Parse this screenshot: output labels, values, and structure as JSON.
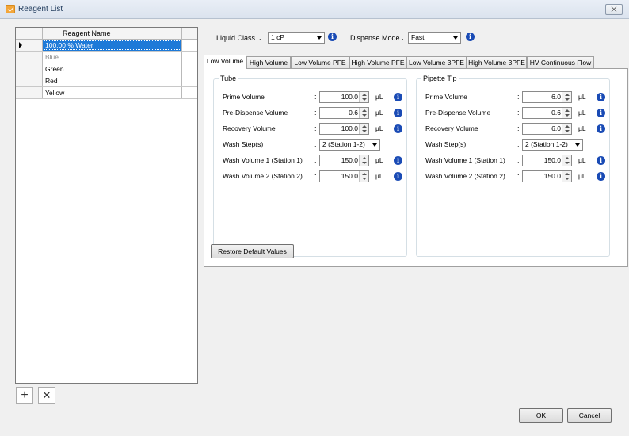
{
  "window": {
    "title": "Reagent List",
    "close_label": "⨉"
  },
  "grid": {
    "header": "Reagent Name",
    "rows": [
      {
        "name": "100.00 % Water"
      },
      {
        "name": "Blue"
      },
      {
        "name": "Green"
      },
      {
        "name": "Red"
      },
      {
        "name": "Yellow"
      }
    ]
  },
  "list_buttons": {
    "add": "+",
    "remove": "✕"
  },
  "liquid_class": {
    "label": "Liquid Class",
    "colon": ":",
    "value": "1 cP"
  },
  "dispense_mode": {
    "label": "Dispense Mode",
    "colon": ":",
    "value": "Fast"
  },
  "info_glyph": "i",
  "tabs": [
    {
      "label": "Low Volume"
    },
    {
      "label": "High Volume"
    },
    {
      "label": "Low Volume PFE"
    },
    {
      "label": "High Volume PFE"
    },
    {
      "label": "Low Volume 3PFE"
    },
    {
      "label": "High Volume 3PFE"
    },
    {
      "label": "HV Continuous Flow"
    }
  ],
  "tube": {
    "title": "Tube",
    "prime": {
      "label": "Prime Volume",
      "value": "100.0",
      "unit": "µL"
    },
    "predispense": {
      "label": "Pre-Dispense Volume",
      "value": "0.6",
      "unit": "µL"
    },
    "recovery": {
      "label": "Recovery Volume",
      "value": "100.0",
      "unit": "µL"
    },
    "wash_steps": {
      "label": "Wash Step(s)",
      "value": "2 (Station 1-2)"
    },
    "wash1": {
      "label": "Wash Volume 1 (Station 1)",
      "value": "150.0",
      "unit": "µL"
    },
    "wash2": {
      "label": "Wash Volume 2 (Station 2)",
      "value": "150.0",
      "unit": "µL"
    }
  },
  "pipette": {
    "title": "Pipette Tip",
    "prime": {
      "label": "Prime Volume",
      "value": "6.0",
      "unit": "µL"
    },
    "predispense": {
      "label": "Pre-Dispense Volume",
      "value": "0.6",
      "unit": "µL"
    },
    "recovery": {
      "label": "Recovery Volume",
      "value": "6.0",
      "unit": "µL"
    },
    "wash_steps": {
      "label": "Wash Step(s)",
      "value": "2 (Station 1-2)"
    },
    "wash1": {
      "label": "Wash Volume 1 (Station 1)",
      "value": "150.0",
      "unit": "µL"
    },
    "wash2": {
      "label": "Wash Volume 2 (Station 2)",
      "value": "150.0",
      "unit": "µL"
    }
  },
  "field_colon": ":",
  "restore_label": "Restore Default Values",
  "ok_label": "OK",
  "cancel_label": "Cancel"
}
